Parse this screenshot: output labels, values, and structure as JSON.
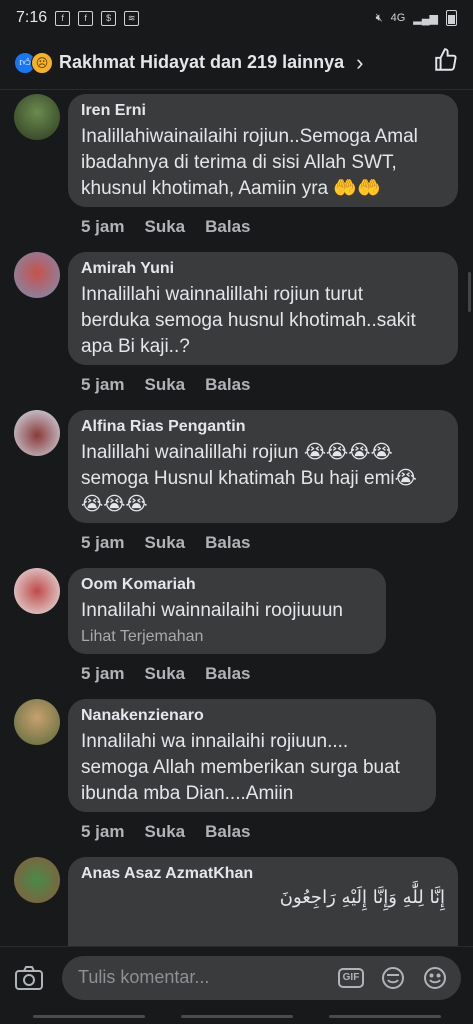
{
  "status": {
    "time": "7:16",
    "network": "4G"
  },
  "header": {
    "title": "Rakhmat Hidayat dan 219 lainnya"
  },
  "comments": [
    {
      "name": "Iren Erni",
      "text": "Inalillahiwainailaihi rojiun..Semoga Amal\nibadahnya di terima di sisi Allah SWT,\nkhusnul khotimah, Aamiin yra 🤲🤲",
      "time": "5 jam",
      "like": "Suka",
      "reply": "Balas"
    },
    {
      "name": "Amirah Yuni",
      "text": "Innalillahi wainnalillahi rojiun turut\nberduka semoga husnul khotimah..sakit\napa Bi kaji..?",
      "time": "5 jam",
      "like": "Suka",
      "reply": "Balas"
    },
    {
      "name": "Alfina Rias Pengantin",
      "text": "Inalillahi wainalillahi rojiun 😭😭😭😭\nsemoga Husnul khatimah Bu haji emi😭\n😭😭😭",
      "time": "5 jam",
      "like": "Suka",
      "reply": "Balas"
    },
    {
      "name": "Oom Komariah",
      "text": "Innalilahi wainnailaihi roojiuuun",
      "translate": "Lihat Terjemahan",
      "time": "5 jam",
      "like": "Suka",
      "reply": "Balas"
    },
    {
      "name": "Nanakenzienaro",
      "text": "Innalilahi wa innailaihi rojiuun....\nsemoga Allah memberikan surga buat\nibunda mba Dian....Amiin",
      "time": "5 jam",
      "like": "Suka",
      "reply": "Balas"
    },
    {
      "name": "Anas Asaz AzmatKhan",
      "text": "إِنَّا لِلَّٰهِ وَإِنَّا إِلَيْهِ رَاجِعُونَ"
    }
  ],
  "composer": {
    "placeholder": "Tulis komentar...",
    "gif_label": "GIF"
  }
}
